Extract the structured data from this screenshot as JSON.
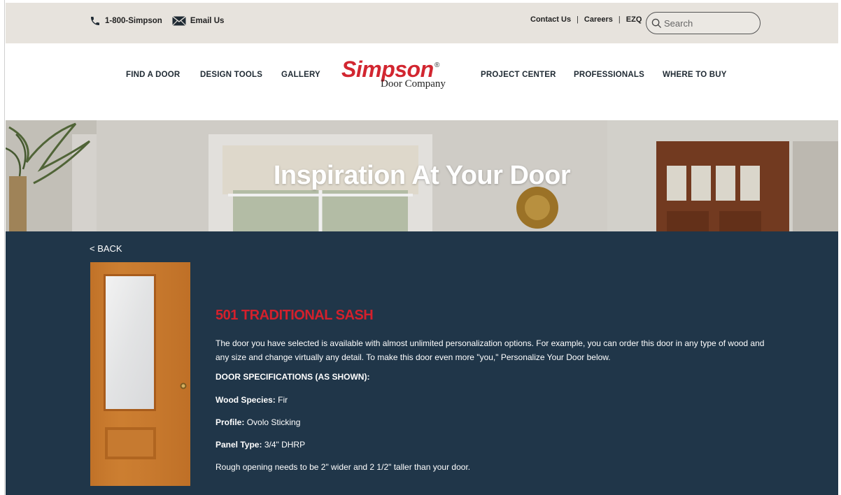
{
  "utility": {
    "phone": "1-800-Simpson",
    "email": "Email Us",
    "links": [
      "Contact Us",
      "Careers",
      "EZQ"
    ],
    "separator": "|",
    "search_placeholder": "Search"
  },
  "nav": {
    "items": [
      "FIND A DOOR",
      "DESIGN TOOLS",
      "GALLERY",
      "PROJECT CENTER",
      "PROFESSIONALS",
      "WHERE TO BUY"
    ]
  },
  "logo": {
    "brand": "Simpson",
    "reg": "®",
    "sub": "Door Company"
  },
  "hero": {
    "title": "Inspiration At Your Door"
  },
  "product": {
    "back": "< BACK",
    "title": "501 TRADITIONAL SASH",
    "description": "The door you have selected is available with almost unlimited personalization options. For example, you can order this door in any type of wood and any size and change virtually any detail. To make this door even more \"you,\" Personalize Your Door below.",
    "specs_heading": "DOOR SPECIFICATIONS (AS SHOWN):",
    "specs": [
      {
        "label": "Wood Species:",
        "value": "Fir"
      },
      {
        "label": "Profile:",
        "value": "Ovolo Sticking"
      },
      {
        "label": "Panel Type:",
        "value": "3/4\" DHRP"
      }
    ],
    "note": "Rough opening needs to be 2\" wider and 2 1/2\" taller than your door."
  },
  "colors": {
    "utility_bg": "#e7e3dd",
    "content_bg": "#203649",
    "brand_red": "#d22630",
    "title_red": "#d4202c"
  },
  "icons": [
    "phone-icon",
    "email-icon",
    "search-icon"
  ]
}
